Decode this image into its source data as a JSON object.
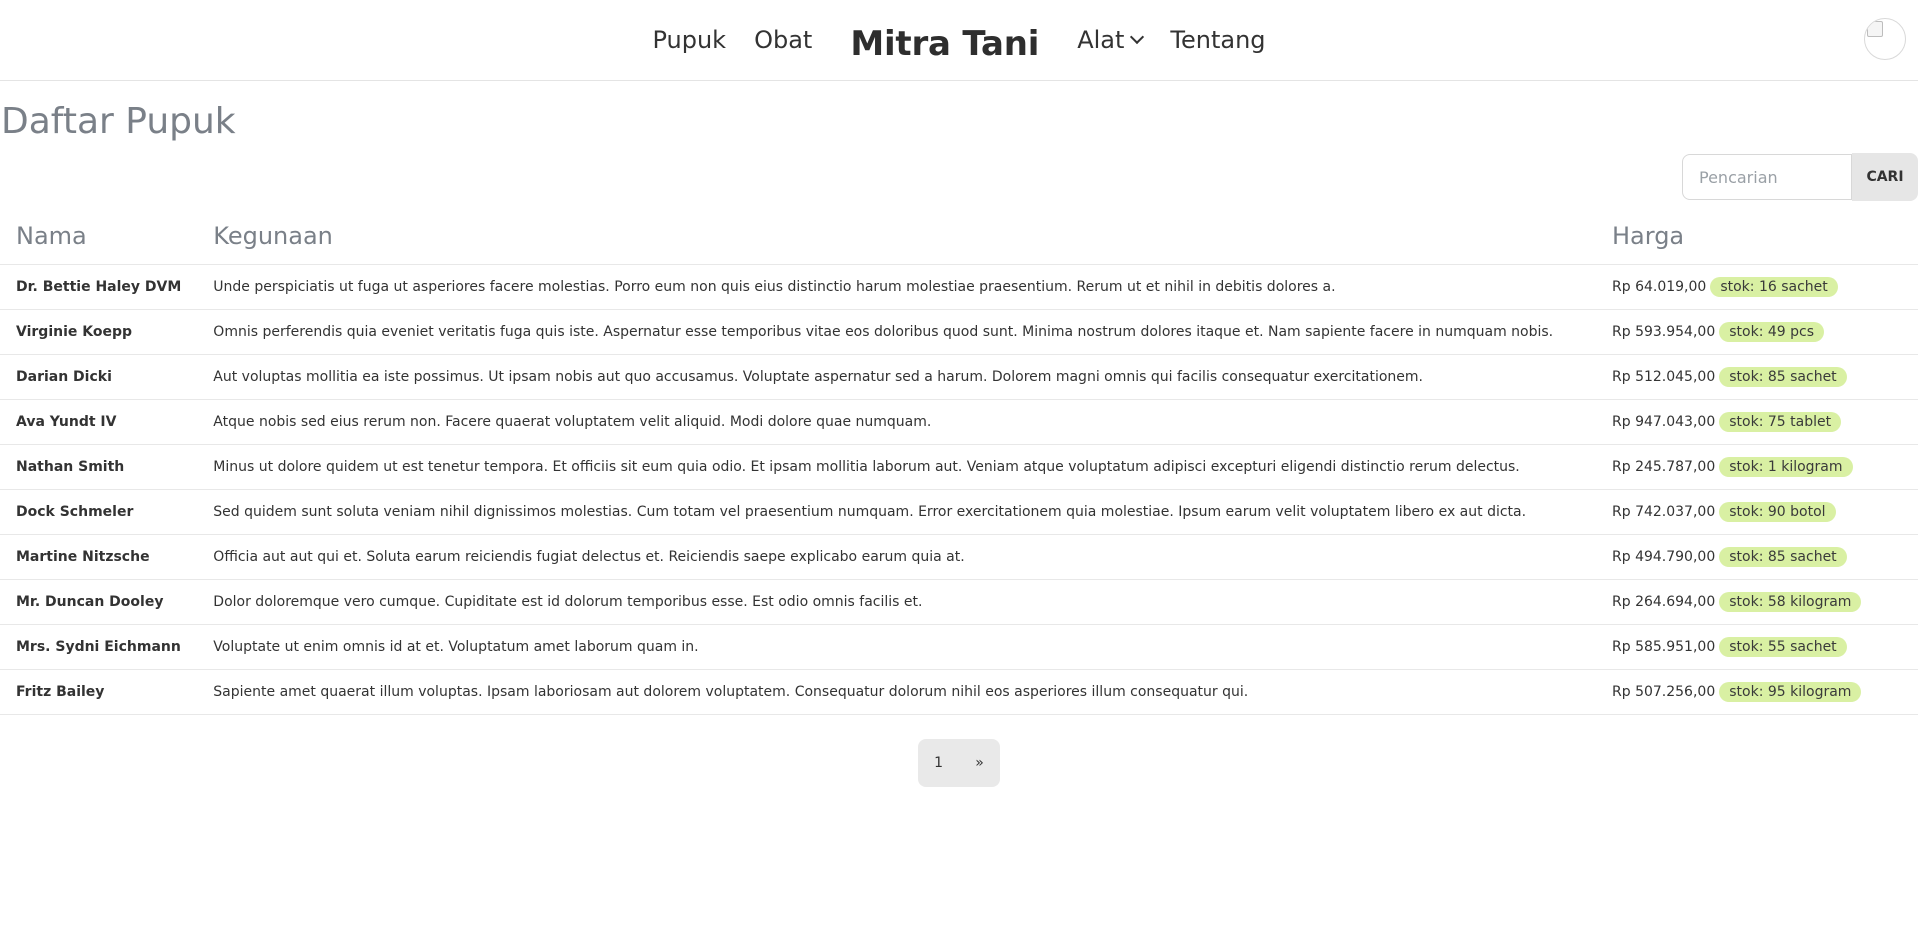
{
  "header": {
    "nav_left": [
      {
        "label": "Pupuk"
      },
      {
        "label": "Obat"
      }
    ],
    "brand": "Mitra Tani",
    "nav_right": [
      {
        "label": "Alat",
        "dropdown": true
      },
      {
        "label": "Tentang"
      }
    ],
    "avatar_icon": "broken-image-icon"
  },
  "page": {
    "title": "Daftar Pupuk"
  },
  "search": {
    "placeholder": "Pencarian",
    "button_label": "CARI"
  },
  "table": {
    "headers": {
      "name": "Nama",
      "usage": "Kegunaan",
      "price": "Harga"
    },
    "rows": [
      {
        "name": "Dr. Bettie Haley DVM",
        "usage": "Unde perspiciatis ut fuga ut asperiores facere molestias. Porro eum non quis eius distinctio harum molestiae praesentium. Rerum ut et nihil in debitis dolores a.",
        "price": "Rp 64.019,00",
        "stock": "stok: 16 sachet"
      },
      {
        "name": "Virginie Koepp",
        "usage": "Omnis perferendis quia eveniet veritatis fuga quis iste. Aspernatur esse temporibus vitae eos doloribus quod sunt. Minima nostrum dolores itaque et. Nam sapiente facere in numquam nobis.",
        "price": "Rp 593.954,00",
        "stock": "stok: 49 pcs"
      },
      {
        "name": "Darian Dicki",
        "usage": "Aut voluptas mollitia ea iste possimus. Ut ipsam nobis aut quo accusamus. Voluptate aspernatur sed a harum. Dolorem magni omnis qui facilis consequatur exercitationem.",
        "price": "Rp 512.045,00",
        "stock": "stok: 85 sachet"
      },
      {
        "name": "Ava Yundt IV",
        "usage": "Atque nobis sed eius rerum non. Facere quaerat voluptatem velit aliquid. Modi dolore quae numquam.",
        "price": "Rp 947.043,00",
        "stock": "stok: 75 tablet"
      },
      {
        "name": "Nathan Smith",
        "usage": "Minus ut dolore quidem ut est tenetur tempora. Et officiis sit eum quia odio. Et ipsam mollitia laborum aut. Veniam atque voluptatum adipisci excepturi eligendi distinctio rerum delectus.",
        "price": "Rp 245.787,00",
        "stock": "stok: 1 kilogram"
      },
      {
        "name": "Dock Schmeler",
        "usage": "Sed quidem sunt soluta veniam nihil dignissimos molestias. Cum totam vel praesentium numquam. Error exercitationem quia molestiae. Ipsum earum velit voluptatem libero ex aut dicta.",
        "price": "Rp 742.037,00",
        "stock": "stok: 90 botol"
      },
      {
        "name": "Martine Nitzsche",
        "usage": "Officia aut aut qui et. Soluta earum reiciendis fugiat delectus et. Reiciendis saepe explicabo earum quia at.",
        "price": "Rp 494.790,00",
        "stock": "stok: 85 sachet"
      },
      {
        "name": "Mr. Duncan Dooley",
        "usage": "Dolor doloremque vero cumque. Cupiditate est id dolorum temporibus esse. Est odio omnis facilis et.",
        "price": "Rp 264.694,00",
        "stock": "stok: 58 kilogram"
      },
      {
        "name": "Mrs. Sydni Eichmann",
        "usage": "Voluptate ut enim omnis id at et. Voluptatum amet laborum quam in.",
        "price": "Rp 585.951,00",
        "stock": "stok: 55 sachet"
      },
      {
        "name": "Fritz Bailey",
        "usage": "Sapiente amet quaerat illum voluptas. Ipsam laboriosam aut dolorem voluptatem. Consequatur dolorum nihil eos asperiores illum consequatur qui.",
        "price": "Rp 507.256,00",
        "stock": "stok: 95 kilogram"
      }
    ]
  },
  "pagination": {
    "current": "1",
    "next": "»"
  }
}
